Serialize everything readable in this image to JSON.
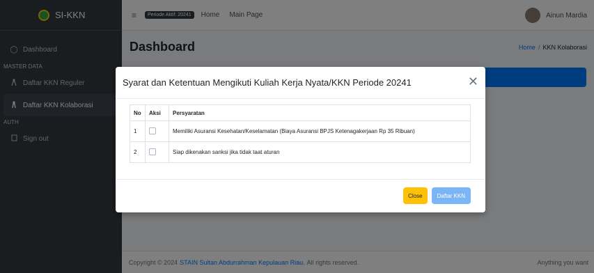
{
  "brand": {
    "name": "SI-KKN"
  },
  "sidebar": {
    "items": [
      {
        "label": "Dashboard",
        "icon": "dashboard-icon"
      },
      {
        "header": "MASTER DATA"
      },
      {
        "label": "Daftar KKN Reguler",
        "icon": "person-icon"
      },
      {
        "label": "Daftar KKN Kolaborasi",
        "icon": "person-icon",
        "active": true
      },
      {
        "header": "AUTH"
      },
      {
        "label": "Sign out",
        "icon": "signout-icon"
      }
    ]
  },
  "topbar": {
    "period_badge": "Periode Aktif: 20241",
    "links": [
      "Home",
      "Main Page"
    ],
    "user_name": "Ainun Mardia"
  },
  "content": {
    "title": "Dashboard",
    "breadcrumb": {
      "home": "Home",
      "separator": "/",
      "current": "KKN Kolaborasi"
    }
  },
  "modal": {
    "title": "Syarat dan Ketentuan Mengikuti Kuliah Kerja Nyata/KKN Periode 20241",
    "columns": [
      "No",
      "Aksi",
      "Persyaratan"
    ],
    "rows": [
      {
        "no": "1",
        "requirement": "Memiliki Asuransi Kesehatan/Keselamatan (Biaya Asuransi BPJS Ketenagakerjaan Rp 35 Ribuan)"
      },
      {
        "no": "2",
        "requirement": "Siap dikenakan sanksi jika tidak taat aturan"
      }
    ],
    "buttons": {
      "close": "Close",
      "register": "Daftar KKN"
    }
  },
  "footer": {
    "prefix": "Copyright © 2024",
    "link": "STAIN Sultan Abdurrahman Kepulauan Riau.",
    "suffix": "All rights reserved.",
    "right": "Anything you want"
  },
  "colors": {
    "sidebar_bg": "#343a40",
    "primary": "#007bff",
    "warning": "#ffc107",
    "register_button": "#7cb5f6"
  }
}
